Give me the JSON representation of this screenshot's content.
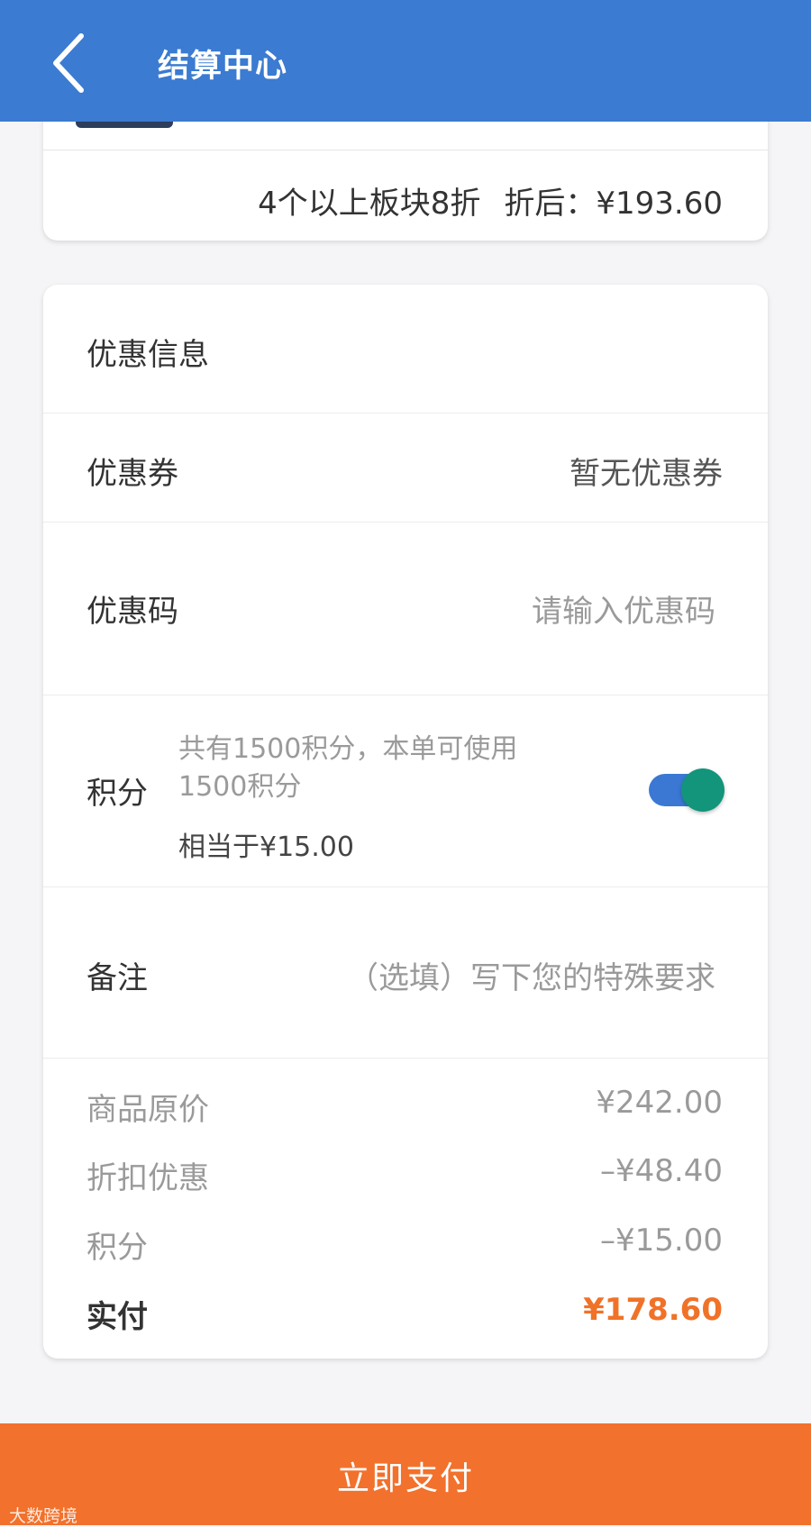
{
  "header": {
    "title": "结算中心",
    "back_icon": "chevron-left-icon"
  },
  "order_summary": {
    "discount_rule": "4个以上板块8折",
    "after_discount": "折后：¥193.60"
  },
  "promotions": {
    "section_title": "优惠信息",
    "coupon": {
      "label": "优惠券",
      "value": "暂无优惠券"
    },
    "promo_code": {
      "label": "优惠码",
      "placeholder": "请输入优惠码"
    },
    "points": {
      "label": "积分",
      "description": "共有1500积分，本单可使用1500积分",
      "equivalent": "相当于¥15.00",
      "toggle_on": true
    },
    "remark": {
      "label": "备注",
      "placeholder": "（选填）写下您的特殊要求"
    }
  },
  "price_breakdown": {
    "original_label": "商品原价",
    "original_value": "¥242.00",
    "discount_label": "折扣优惠",
    "discount_value": "–¥48.40",
    "points_label": "积分",
    "points_value": "–¥15.00",
    "total_label": "实付",
    "total_value": "¥178.60"
  },
  "pay_button": {
    "label": "立即支付"
  },
  "watermark": "大数跨境",
  "colors": {
    "header_bg": "#3b7bd1",
    "accent_orange": "#f2712c",
    "total_price": "#f07228",
    "toggle_track": "#3a78d4",
    "toggle_knob": "#12957a"
  }
}
